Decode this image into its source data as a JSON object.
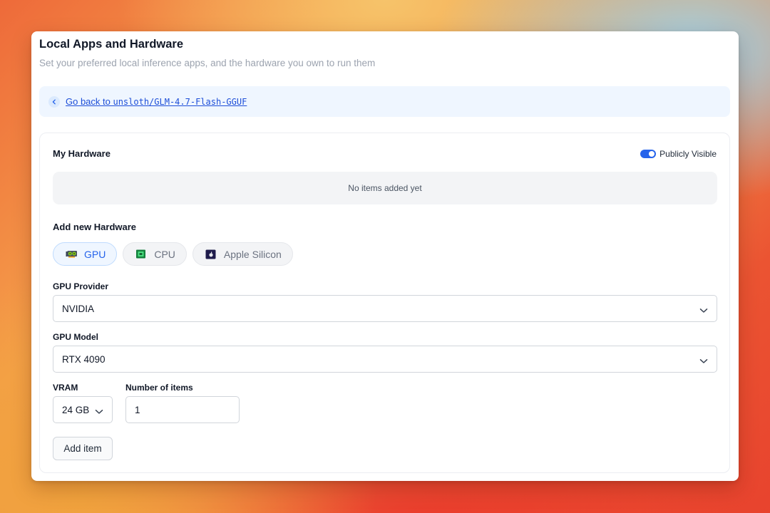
{
  "page": {
    "title": "Local Apps and Hardware",
    "subtitle": "Set your preferred local inference apps, and the hardware you own to run them"
  },
  "back": {
    "prefix": "Go back to ",
    "repo": "unsloth/GLM-4.7-Flash-GGUF",
    "icon": "chevron-left-icon"
  },
  "hardware": {
    "title": "My Hardware",
    "visibility_label": "Publicly Visible",
    "visibility_on": true,
    "empty_text": "No items added yet"
  },
  "add": {
    "title": "Add new Hardware",
    "tabs": [
      {
        "label": "GPU",
        "icon": "gpu-icon",
        "active": true
      },
      {
        "label": "CPU",
        "icon": "cpu-chip-icon",
        "active": false
      },
      {
        "label": "Apple Silicon",
        "icon": "apple-silicon-icon",
        "active": false
      }
    ],
    "provider_label": "GPU Provider",
    "provider_value": "NVIDIA",
    "model_label": "GPU Model",
    "model_value": "RTX 4090",
    "vram_label": "VRAM",
    "vram_value": "24 GB",
    "count_label": "Number of items",
    "count_value": "1",
    "submit_label": "Add item"
  },
  "colors": {
    "accent": "#2563eb",
    "link": "#1d4ed8",
    "chip_active_bg": "#eff6ff"
  }
}
